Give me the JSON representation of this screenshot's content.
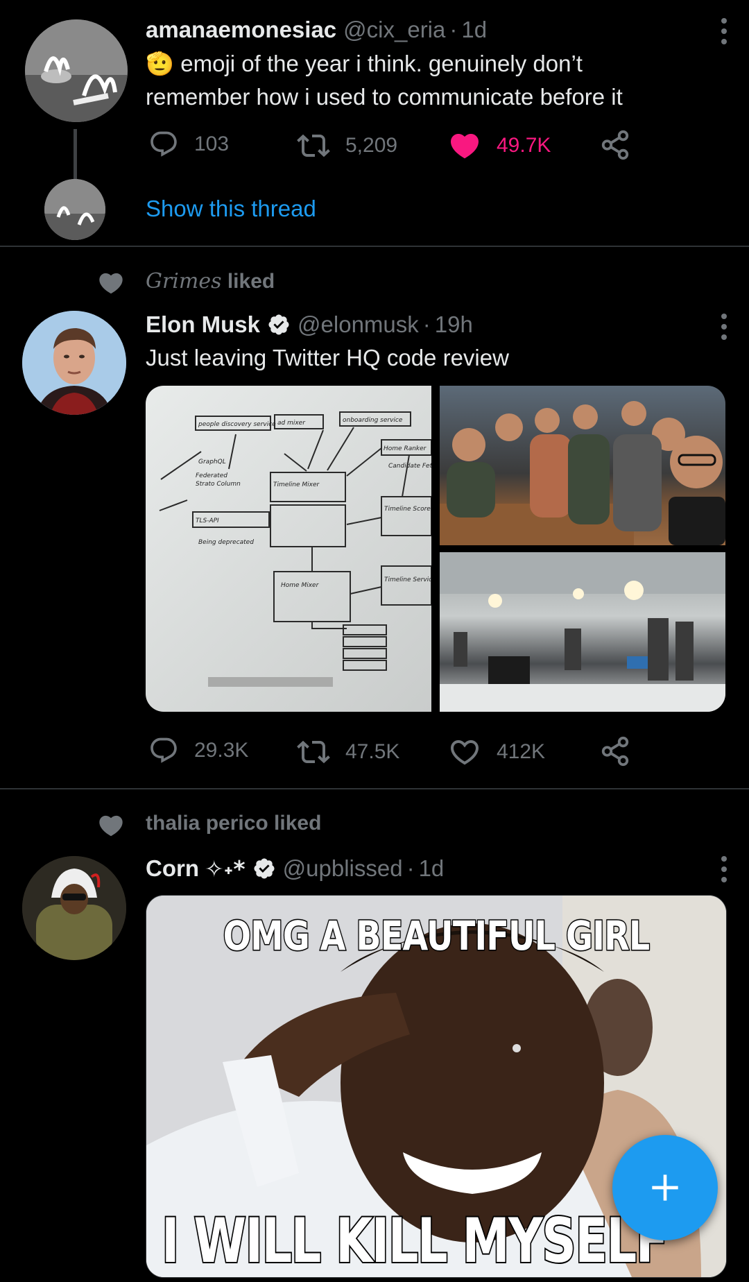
{
  "tweets": [
    {
      "name": "amanaemonesiac",
      "handle": "@cix_eria",
      "sep": "·",
      "time": "1d",
      "emoji": "🫡",
      "text_line1": " emoji of the year i think. genuinely don’t",
      "text_line2": "remember how i used to communicate before it",
      "replies": "103",
      "retweets": "5,209",
      "likes": "49.7K",
      "liked": true,
      "show_thread": "Show this thread"
    },
    {
      "liked_by": "Grimes",
      "liked_suffix": " liked",
      "name": "Elon Musk",
      "verified": true,
      "handle": "@elonmusk",
      "sep": "·",
      "time": "19h",
      "text": "Just leaving Twitter HQ code review",
      "replies": "29.3K",
      "retweets": "47.5K",
      "likes": "412K",
      "liked": false,
      "whiteboard": {
        "people_discovery": "people discovery service",
        "ad_mixer": "ad mixer",
        "onboarding": "onboarding service",
        "home_ranker": "Home Ranker",
        "candidate_fetch": "Candidate Fetch",
        "graphql": "GraphQL",
        "federated": "Federated",
        "strato": "Strato Column",
        "timeline_mixer": "Timeline Mixer",
        "tls_api": "TLS-API",
        "being_deprecated": "Being deprecated",
        "timeline_scorer": "Timeline Scorer",
        "home_mixer": "Home Mixer",
        "timeline_service": "Timeline Service"
      }
    },
    {
      "liked_by": "thalia perico",
      "liked_suffix": " liked",
      "name": "Corn",
      "name_symbols": "✧˖*",
      "verified": true,
      "handle": "@upblissed",
      "sep": "·",
      "time": "1d",
      "meme_top": "OMG A BEAUTIFUL GIRL",
      "meme_bottom": "I WILL KILL MYSELF"
    }
  ],
  "colors": {
    "background": "#000000",
    "accent": "#1d9bf0",
    "like": "#f91880",
    "muted": "#71767b",
    "text": "#e7e9ea"
  },
  "icons": {
    "reply": "reply-icon",
    "retweet": "retweet-icon",
    "like": "heart-icon",
    "share": "share-icon",
    "more": "more-icon",
    "compose": "plus-icon"
  }
}
